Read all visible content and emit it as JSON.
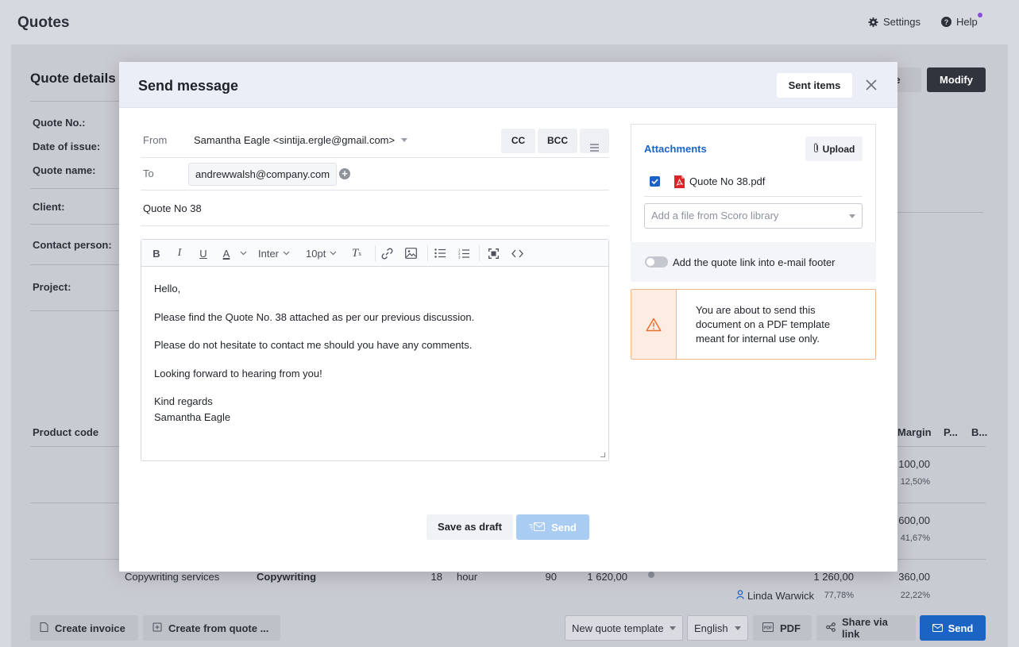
{
  "app": {
    "title": "Quotes",
    "settings": "Settings",
    "help": "Help"
  },
  "background": {
    "heading": "Quote details",
    "ghost_button": "te",
    "modify_button": "Modify",
    "labels": [
      "Quote No.:",
      "Date of issue:",
      "Quote name:",
      "Client:",
      "Contact person:",
      "Project:"
    ],
    "columns": {
      "product_code": "Product code",
      "margin": "Margin",
      "p": "P...",
      "b": "B..."
    },
    "rows": [
      {
        "margin": "100,00",
        "margin_pct": "12,50%"
      },
      {
        "margin": "600,00",
        "margin_pct": "41,67%"
      },
      {
        "service": "Copywriting services",
        "code": "Copywriting",
        "qty": "18",
        "unit": "hour",
        "price": "90",
        "total": "1 620,00",
        "cost": "1 260,00",
        "margin": "360,00",
        "person": "Linda Warwick",
        "person_pct": "77,78%",
        "margin_pct": "22,22%"
      }
    ]
  },
  "bottom_bar": {
    "create_invoice": "Create invoice",
    "create_from_quote": "Create from quote ...",
    "template_select": "New quote template",
    "language_select": "English",
    "pdf": "PDF",
    "share": "Share via link",
    "send": "Send"
  },
  "modal": {
    "title": "Send message",
    "sent_items": "Sent items",
    "from_label": "From",
    "from_value": "Samantha Eagle <sintija.ergle@gmail.com>",
    "cc": "CC",
    "bcc": "BCC",
    "to_label": "To",
    "to_value": "andrewwalsh@company.com",
    "subject": "Quote No 38",
    "toolbar": {
      "font": "Inter",
      "size": "10pt"
    },
    "body": {
      "greeting": "Hello,",
      "line1": "Please find the Quote No. 38 attached as per our previous discussion.",
      "line2": "Please do not hesitate to contact me should you have any comments.",
      "line3": "Looking forward to hearing from you!",
      "sign1": "Kind regards",
      "sign2": "Samantha Eagle"
    },
    "save_draft": "Save as draft",
    "send": "Send",
    "attachments": {
      "title": "Attachments",
      "upload": "Upload",
      "file": "Quote No 38.pdf",
      "file_checked": true,
      "library_placeholder": "Add a file from Scoro library"
    },
    "footer_toggle_label": "Add the quote link into e-mail footer",
    "footer_toggle_on": false,
    "warning": "You are about to send this document on a PDF template meant for internal use only."
  },
  "colors": {
    "accent": "#1c64c4",
    "warning_border": "#f2b58c",
    "warning_icon": "#e8702e"
  }
}
